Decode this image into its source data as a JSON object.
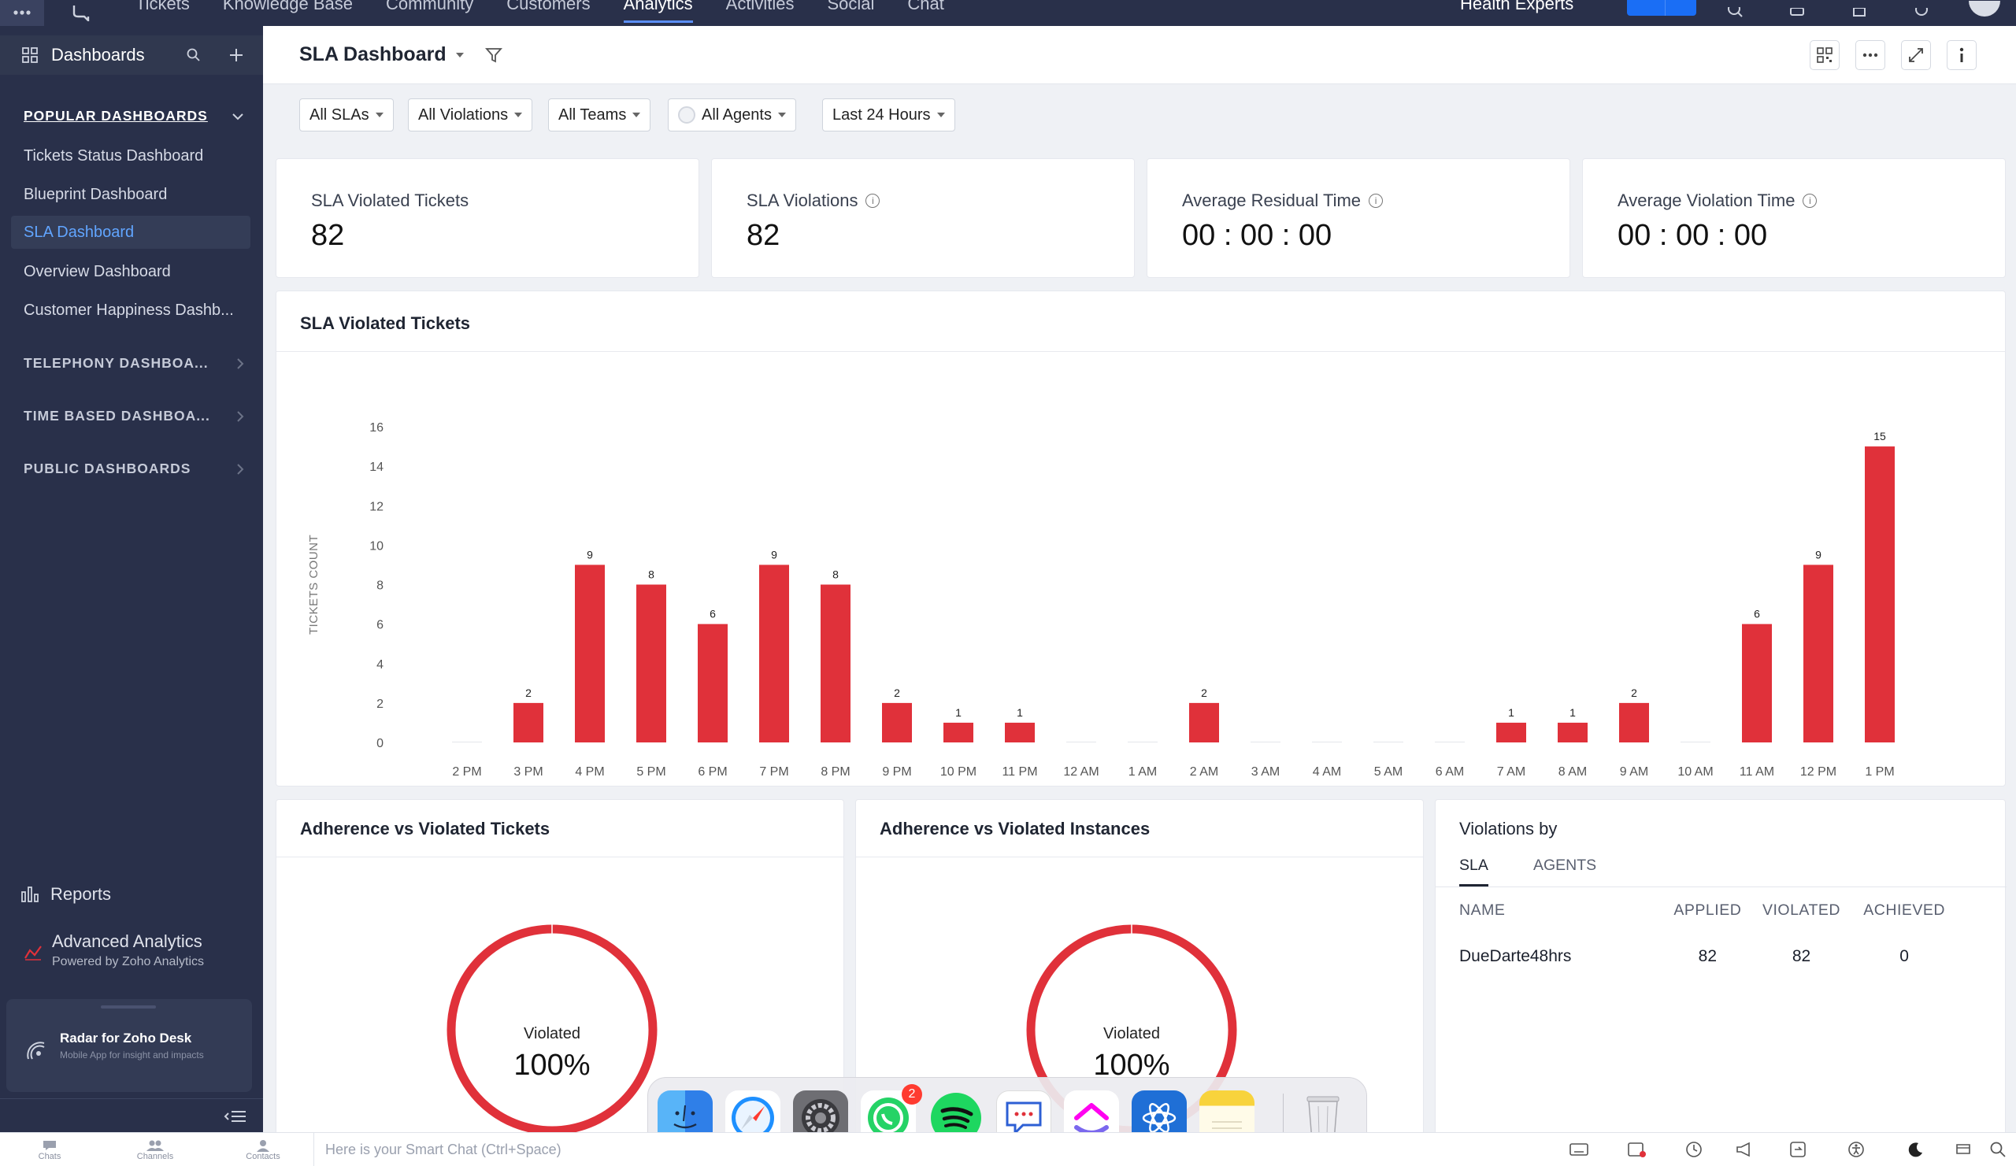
{
  "topnav": {
    "tabs": [
      "Tickets",
      "Knowledge Base",
      "Community",
      "Customers",
      "Analytics",
      "Activities",
      "Social",
      "Chat"
    ],
    "active_tab": "Analytics",
    "department": "Health Experts"
  },
  "sidebar": {
    "title": "Dashboards",
    "popular_section": "POPULAR DASHBOARDS",
    "popular_items": [
      "Tickets Status Dashboard",
      "Blueprint Dashboard",
      "SLA Dashboard",
      "Overview Dashboard",
      "Customer Happiness Dashb..."
    ],
    "active_item": "SLA Dashboard",
    "other_sections": [
      "TELEPHONY DASHBOA...",
      "TIME BASED DASHBOA...",
      "PUBLIC DASHBOARDS"
    ],
    "reports": "Reports",
    "advanced_analytics": "Advanced Analytics",
    "advanced_sub": "Powered by Zoho Analytics",
    "radar_title": "Radar for Zoho Desk",
    "radar_sub": "Mobile App for insight and impacts"
  },
  "header": {
    "title": "SLA Dashboard"
  },
  "filters": [
    "All SLAs",
    "All Violations",
    "All Teams",
    "All Agents",
    "Last 24 Hours"
  ],
  "kpis": [
    {
      "label": "SLA Violated Tickets",
      "value": "82",
      "info": false
    },
    {
      "label": "SLA Violations",
      "value": "82",
      "info": true
    },
    {
      "label": "Average Residual Time",
      "value": "00 : 00 : 00",
      "info": true
    },
    {
      "label": "Average Violation Time",
      "value": "00 : 00 : 00",
      "info": true
    }
  ],
  "chart_title": "SLA Violated Tickets",
  "chart_data": {
    "type": "bar",
    "categories": [
      "2 PM",
      "3 PM",
      "4 PM",
      "5 PM",
      "6 PM",
      "7 PM",
      "8 PM",
      "9 PM",
      "10 PM",
      "11 PM",
      "12 AM",
      "1 AM",
      "2 AM",
      "3 AM",
      "4 AM",
      "5 AM",
      "6 AM",
      "7 AM",
      "8 AM",
      "9 AM",
      "10 AM",
      "11 AM",
      "12 PM",
      "1 PM"
    ],
    "values": [
      0,
      2,
      9,
      8,
      6,
      9,
      8,
      2,
      1,
      1,
      0,
      0,
      2,
      0,
      0,
      0,
      0,
      1,
      1,
      2,
      0,
      6,
      9,
      15
    ],
    "ylabel": "TICKETS COUNT",
    "ylim": [
      0,
      16
    ],
    "yticks": [
      0,
      2,
      4,
      6,
      8,
      10,
      12,
      14,
      16
    ],
    "color": "#e0313a"
  },
  "donuts": [
    {
      "title": "Adherence vs Violated Tickets",
      "label": "Violated",
      "value": "100%"
    },
    {
      "title": "Adherence vs Violated Instances",
      "label": "Violated",
      "value": "100%"
    }
  ],
  "violations": {
    "title": "Violations by",
    "tabs": [
      "SLA",
      "AGENTS"
    ],
    "active_tab": "SLA",
    "columns": [
      "NAME",
      "APPLIED",
      "VIOLATED",
      "ACHIEVED"
    ],
    "rows": [
      [
        "DueDarte48hrs",
        "82",
        "82",
        "0"
      ]
    ]
  },
  "dock": {
    "whatsapp_badge": "2"
  },
  "bottombar": {
    "items": [
      "Chats",
      "Channels",
      "Contacts"
    ],
    "smart_chat_placeholder": "Here is your Smart Chat (Ctrl+Space)"
  },
  "colors": {
    "bar": "#e0313a",
    "sidebar": "#29304a",
    "accent": "#61a5ff"
  }
}
